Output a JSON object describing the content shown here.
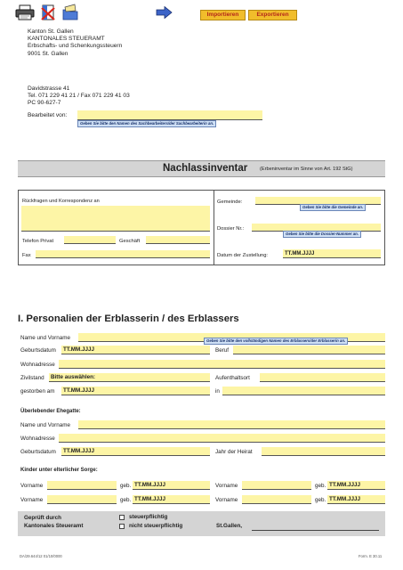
{
  "toolbar": {
    "import_label": "Importieren",
    "export_label": "Exportieren"
  },
  "header": {
    "address_lines": [
      "Kanton St. Gallen",
      "KANTONALES STEUERAMT",
      "Erbschafts- und Schenkungssteuern",
      "9001 St. Gallen"
    ],
    "contact_lines": [
      "Davidstrasse 41",
      "Tel. 071 229 41 21 / Fax 071 229 41 03",
      "PC 90-627-7"
    ],
    "bearbeitet_label": "Bearbeitet von:",
    "bearbeitet_tip": "Geben Sie bitte den Namen des Sachbearbeiters/der Sachbearbeiterin an."
  },
  "title": {
    "main": "Nachlassinventar",
    "sub": "(Erbeninventar im Sinne von Art. 192 StG)"
  },
  "box": {
    "rueckfragen_label": "Rückfragen und Korrespondenz an",
    "telefon_label": "Telefon Privat",
    "geschaeft_label": "Geschäft",
    "fax_label": "Fax",
    "gemeinde_label": "Gemeinde:",
    "gemeinde_tip": "Geben Sie bitte die Gemeinde an.",
    "dossier_label": "Dossier Nr.:",
    "dossier_tip": "Geben Sie bitte die Dossier-Nummer an.",
    "zustellung_label": "Datum der Zustellung:",
    "zustellung_value": "TT.MM.JJJJ"
  },
  "section1": {
    "heading": "I. Personalien der Erblasserin / des Erblassers",
    "name_label": "Name und Vorname",
    "name_tip": "Geben Sie bitte den vollständigen Namen des Erblassers/der Erblasserin an.",
    "geburtsdatum_label": "Geburtsdatum",
    "geburtsdatum_value": "TT.MM.JJJJ",
    "beruf_label": "Beruf",
    "wohnadresse_label": "Wohnadresse",
    "zivilstand_label": "Zivilstand",
    "zivilstand_value": "Bitte auswählen:",
    "aufenthaltsort_label": "Aufenthaltsort",
    "gestorben_label": "gestorben am",
    "gestorben_value": "TT.MM.JJJJ",
    "in_label": "in"
  },
  "ehegatte": {
    "heading": "Überlebender Ehegatte:",
    "name_label": "Name und Vorname",
    "wohnadresse_label": "Wohnadresse",
    "geburtsdatum_label": "Geburtsdatum",
    "geburtsdatum_value": "TT.MM.JJJJ",
    "heirat_label": "Jahr der Heirat"
  },
  "kinder": {
    "heading": "Kinder unter elterlicher Sorge:",
    "rows": [
      {
        "vorname_l": "Vorname",
        "geb_l": "geb.",
        "date_l": "TT.MM.JJJJ",
        "vorname_r": "Vorname",
        "geb_r": "geb.",
        "date_r": "TT.MM.JJJJ"
      },
      {
        "vorname_l": "Vorname",
        "geb_l": "geb.",
        "date_l": "TT.MM.JJJJ",
        "vorname_r": "Vorname",
        "geb_r": "geb.",
        "date_r": "TT.MM.JJJJ"
      }
    ]
  },
  "footer_box": {
    "geprueft_line1": "Geprüft durch",
    "geprueft_line2": "Kantonales Steueramt",
    "steuerpflichtig": "steuerpflichtig",
    "nicht_steuerpflichtig": "nicht steuerpflichtig",
    "ort": "St.Gallen,"
  },
  "footer": {
    "left": "DA/29.644/12 01/10/0000",
    "right": "Form. E 30.11"
  },
  "colors": {
    "field_yellow": "#fdf5a6",
    "button_gold": "#f1bd2b",
    "title_bar_gray": "#d4d4d4",
    "tip_blue": "#cfe0f5"
  }
}
